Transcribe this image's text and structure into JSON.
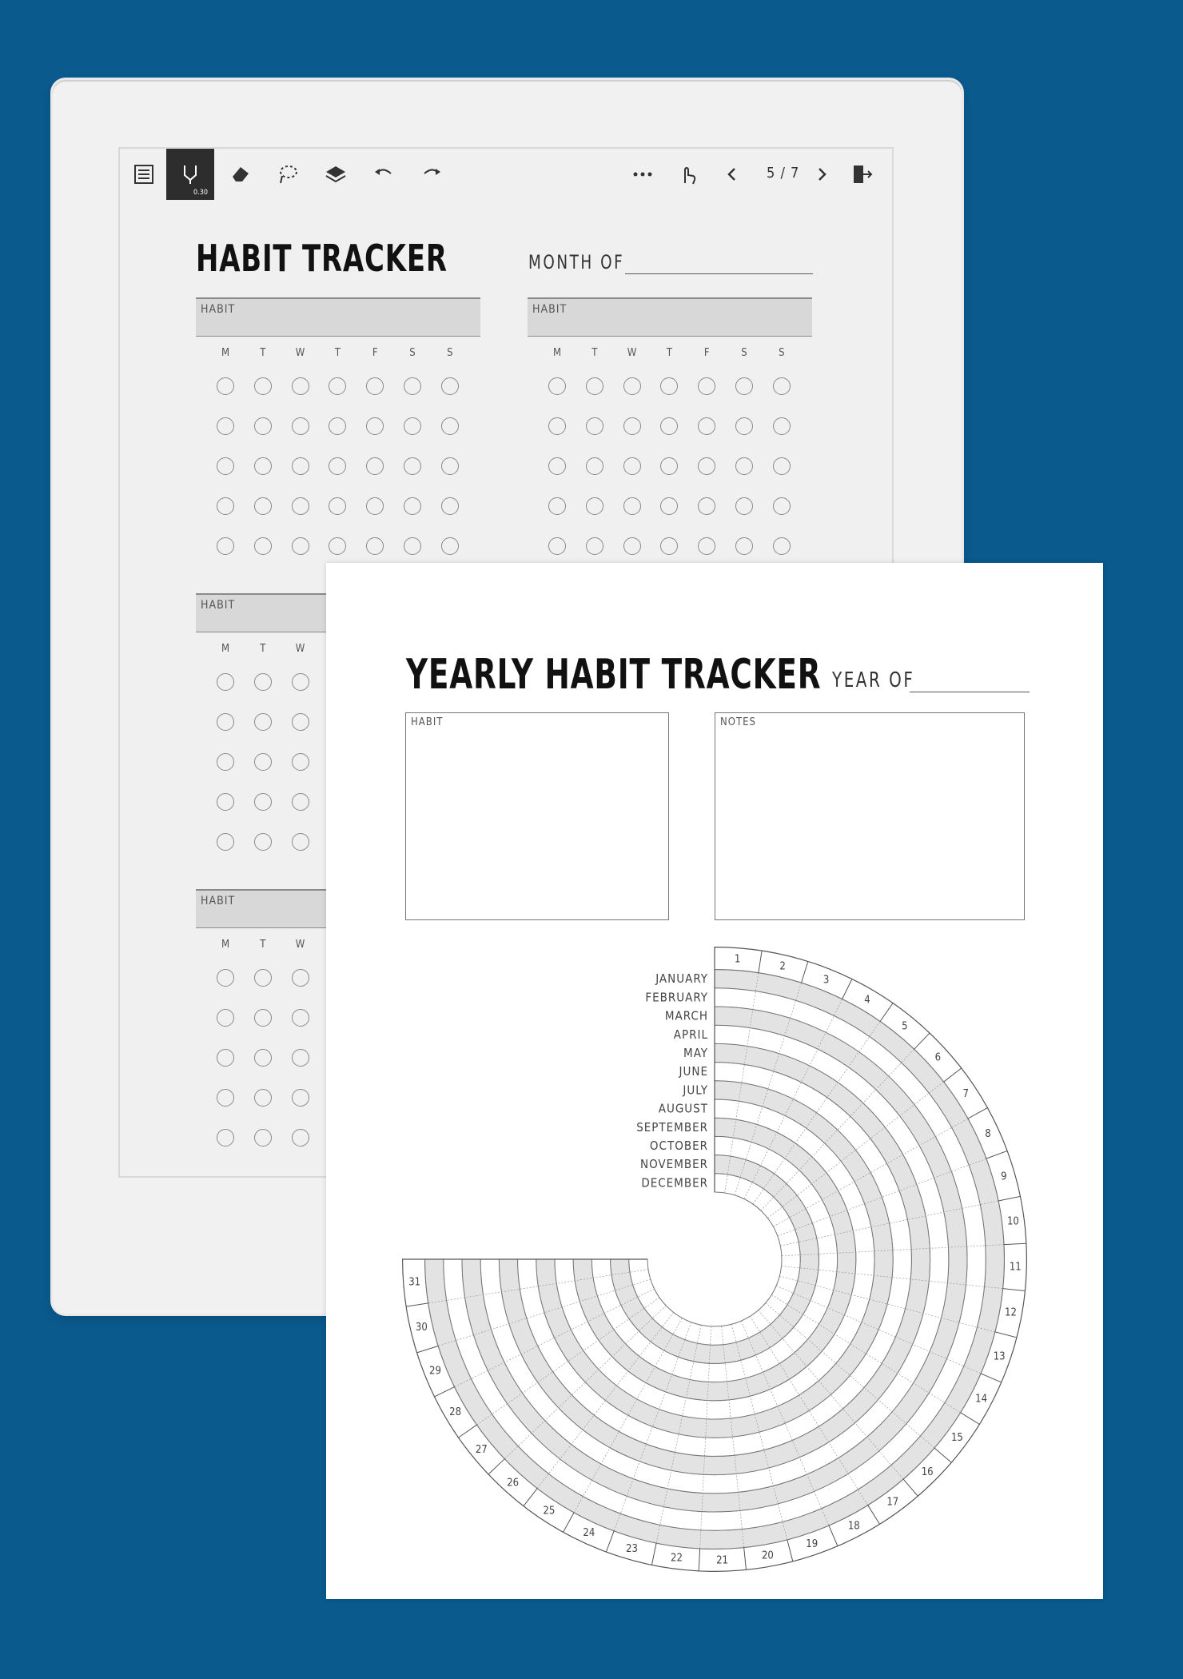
{
  "device": {
    "toolbar": {
      "page_indicator": "5 / 7",
      "pen_size": "0.30",
      "icons": [
        "list-icon",
        "pen-icon",
        "eraser-icon",
        "lasso-icon",
        "layers-icon",
        "undo-icon",
        "redo-icon",
        "more-icon",
        "touch-icon",
        "prev-page-icon",
        "next-page-icon",
        "exit-icon"
      ]
    },
    "page": {
      "title": "HABIT TRACKER",
      "month_label": "MONTH OF",
      "habit_label": "HABIT",
      "weekdays": [
        "M",
        "T",
        "W",
        "T",
        "F",
        "S",
        "S"
      ]
    }
  },
  "paper": {
    "title": "YEARLY HABIT TRACKER",
    "year_label": "YEAR OF",
    "habit_box_label": "HABIT",
    "notes_box_label": "NOTES",
    "months": [
      "JANUARY",
      "FEBRUARY",
      "MARCH",
      "APRIL",
      "MAY",
      "JUNE",
      "JULY",
      "AUGUST",
      "SEPTEMBER",
      "OCTOBER",
      "NOVEMBER",
      "DECEMBER"
    ],
    "days": [
      "1",
      "2",
      "3",
      "4",
      "5",
      "6",
      "7",
      "8",
      "9",
      "10",
      "11",
      "12",
      "13",
      "14",
      "15",
      "16",
      "17",
      "18",
      "19",
      "20",
      "21",
      "22",
      "23",
      "24",
      "25",
      "26",
      "27",
      "28",
      "29",
      "30",
      "31"
    ]
  },
  "colors": {
    "background": "#0a5a8e",
    "ring_shade": "#e3e3e3"
  }
}
